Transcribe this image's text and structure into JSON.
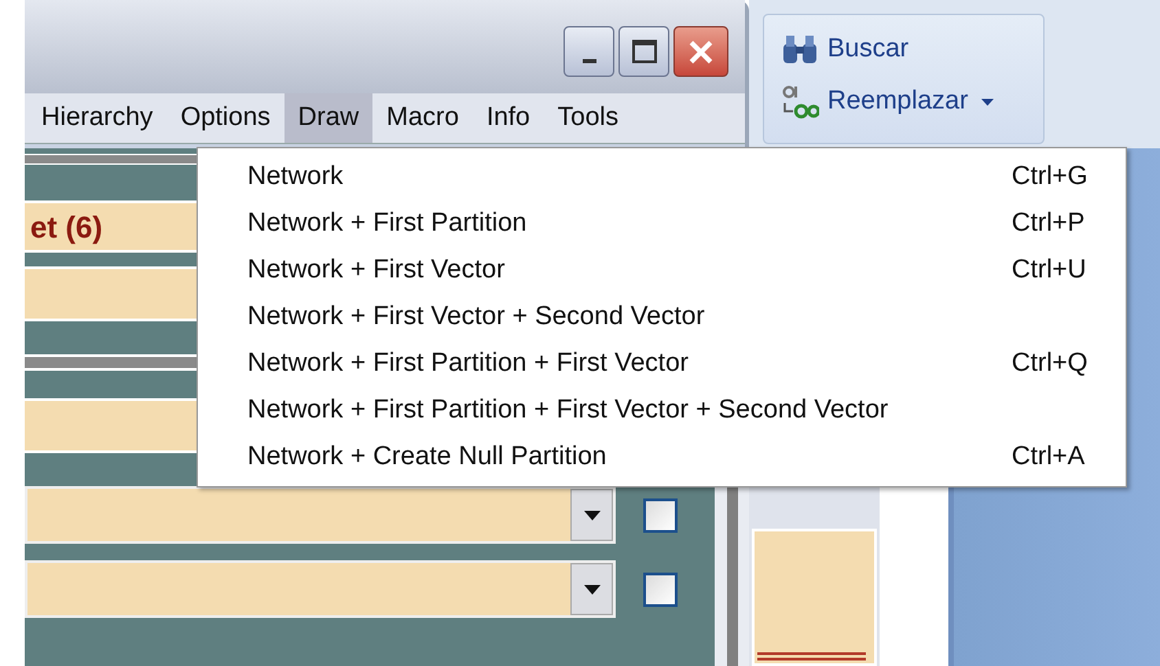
{
  "menubar": [
    {
      "label": "Hierarchy",
      "selected": false
    },
    {
      "label": "Options",
      "selected": false
    },
    {
      "label": "Draw",
      "selected": true
    },
    {
      "label": "Macro",
      "selected": false
    },
    {
      "label": "Info",
      "selected": false
    },
    {
      "label": "Tools",
      "selected": false
    }
  ],
  "draw_menu": [
    {
      "label": "Network",
      "shortcut": "Ctrl+G"
    },
    {
      "label": "Network + First Partition",
      "shortcut": "Ctrl+P"
    },
    {
      "label": "Network + First Vector",
      "shortcut": "Ctrl+U"
    },
    {
      "label": "Network + First Vector + Second Vector"
    },
    {
      "label": "Network + First Partition + First Vector",
      "shortcut": "Ctrl+Q"
    },
    {
      "label": "Network + First Partition + First Vector + Second Vector"
    },
    {
      "label": "Network + Create Null Partition",
      "shortcut": "Ctrl+A"
    }
  ],
  "ribbon": [
    {
      "label": "Buscar",
      "kind": "find"
    },
    {
      "label": "Reemplazar",
      "kind": "replace",
      "dropdown": true
    }
  ],
  "panel_rows": [
    {
      "kind": "title",
      "text": "et (6)"
    },
    {
      "kind": "blank"
    },
    {
      "kind": "separator"
    },
    {
      "kind": "blank"
    },
    {
      "kind": "combo",
      "checked": false
    },
    {
      "kind": "combo",
      "checked": false
    }
  ]
}
